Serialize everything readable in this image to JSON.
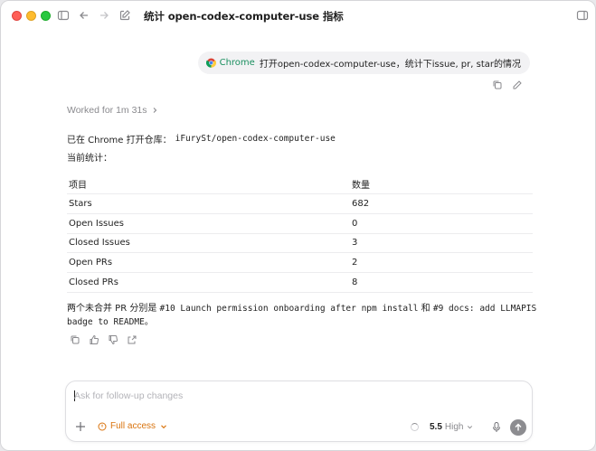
{
  "window": {
    "title": "统计 open-codex-computer-use 指标",
    "more": "···"
  },
  "user_message": {
    "app": "Chrome",
    "text": "打开open-codex-computer-use，统计下issue, pr, star的情况"
  },
  "worked": {
    "label": "Worked for 1m 31s"
  },
  "answer": {
    "intro": "已在 Chrome 打开仓库：",
    "repo": "iFurySt/open-codex-computer-use",
    "stats_label": "当前统计："
  },
  "table": {
    "headers": [
      "项目",
      "数量"
    ],
    "rows": [
      [
        "Stars",
        "682"
      ],
      [
        "Open Issues",
        "0"
      ],
      [
        "Closed Issues",
        "3"
      ],
      [
        "Open PRs",
        "2"
      ],
      [
        "Closed PRs",
        "8"
      ]
    ]
  },
  "summary": {
    "prefix": "两个未合并 PR 分别是 ",
    "pr1": "#10 Launch permission onboarding after npm install",
    "mid": " 和 ",
    "pr2": "#9 docs: add LLMAPIS badge to README",
    "suffix": "。"
  },
  "composer": {
    "placeholder": "Ask for follow-up changes",
    "access_label": "Full access",
    "model_version": "5.5",
    "model_level": "High"
  },
  "colors": {
    "accent_access": "#d9730d",
    "chrome_label": "#1a8f5f"
  }
}
